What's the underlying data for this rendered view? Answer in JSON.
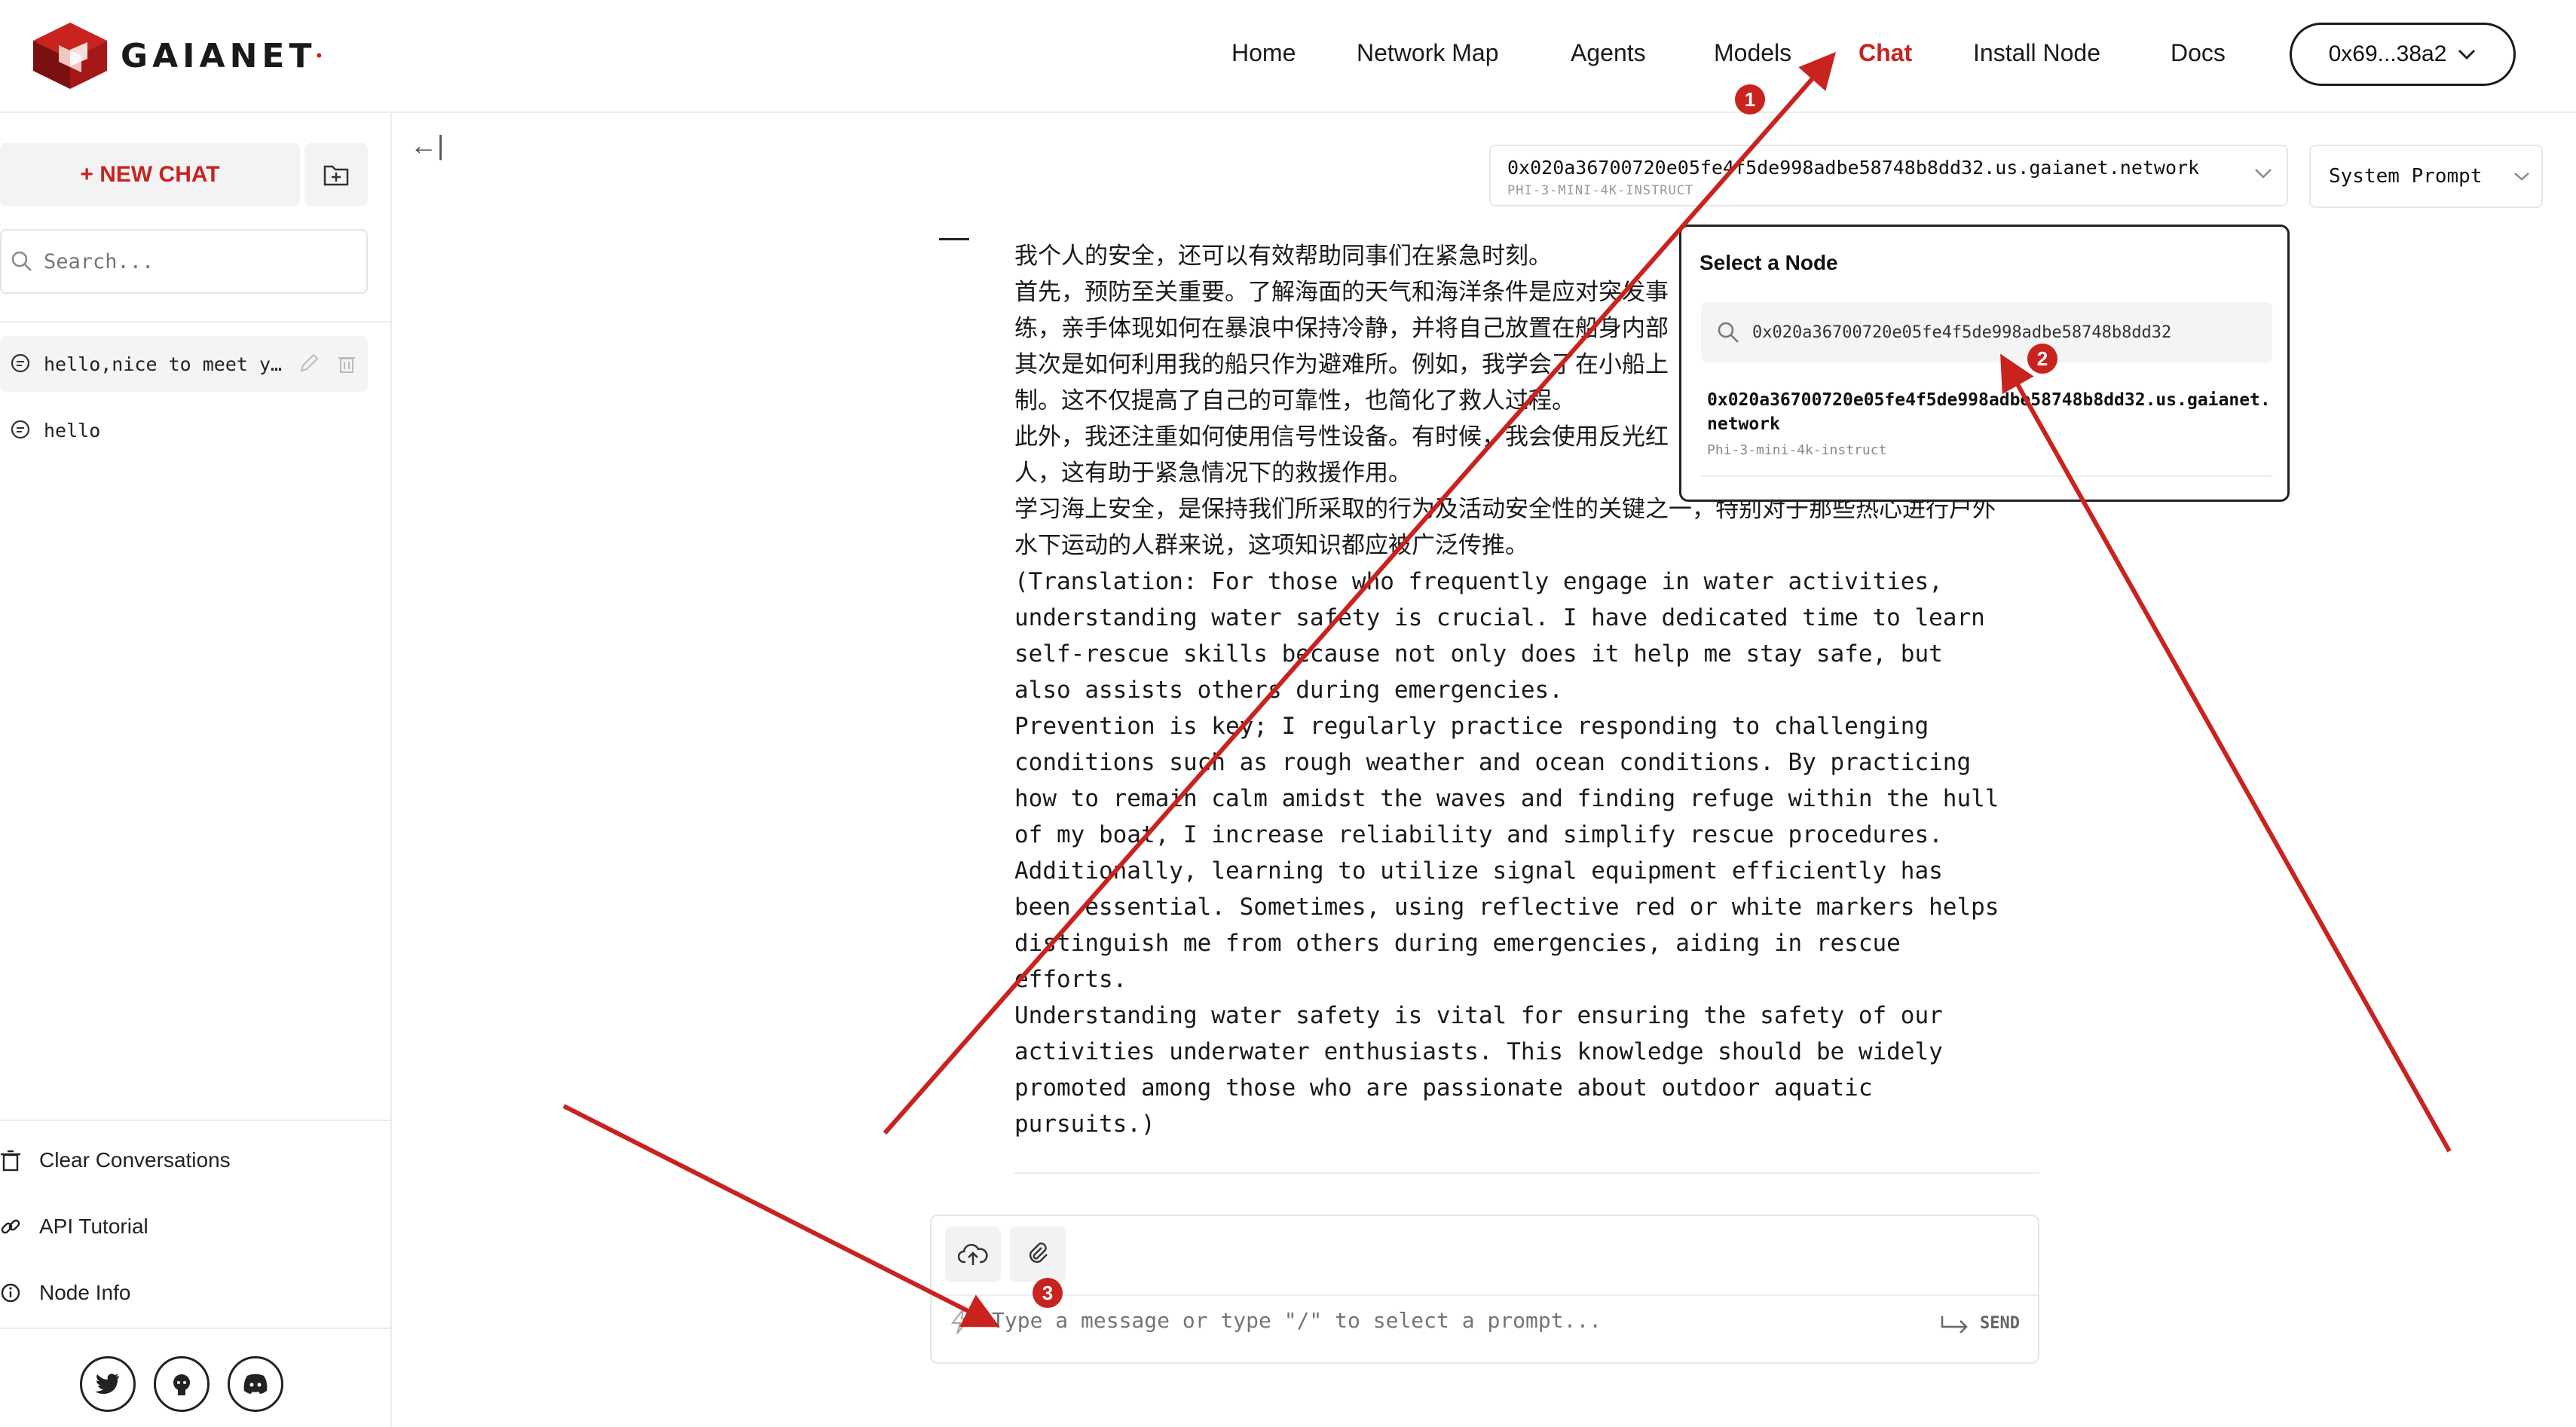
{
  "header": {
    "logo_text": "GAIANET",
    "nav": [
      {
        "label": "Home"
      },
      {
        "label": "Network Map"
      },
      {
        "label": "Agents"
      },
      {
        "label": "Models"
      },
      {
        "label": "Chat"
      },
      {
        "label": "Install Node"
      },
      {
        "label": "Docs"
      }
    ],
    "wallet_label": "0x69...38a2"
  },
  "sidebar": {
    "new_chat_label": "+ NEW CHAT",
    "search_placeholder": "Search...",
    "conversations": [
      {
        "title": "hello,nice to meet y…"
      },
      {
        "title": "hello"
      }
    ],
    "links": [
      {
        "label": "Clear Conversations"
      },
      {
        "label": "API Tutorial"
      },
      {
        "label": "Node Info"
      }
    ]
  },
  "main": {
    "collapse_glyph": "←|",
    "node": {
      "url": "0x020a36700720e05fe4f5de998adbe58748b8dd32.us.gaianet.network",
      "model": "PHI-3-MINI-4K-INSTRUCT"
    },
    "system_prompt_label": "System Prompt",
    "message_lines_zh": [
      "我个人的安全，还可以有效帮助同事们在紧急时刻。",
      "首先，预防至关重要。了解海面的天气和海洋条件是应对突发事",
      "练，亲手体现如何在暴浪中保持冷静，并将自己放置在船身内部",
      "其次是如何利用我的船只作为避难所。例如，我学会了在小船上",
      "制。这不仅提高了自己的可靠性，也简化了救人过程。",
      "此外，我还注重如何使用信号性设备。有时候，我会使用反光红",
      "人，这有助于紧急情况下的救援作用。",
      "学习海上安全，是保持我们所采取的行为及活动安全性的关键之一，特别对于那些热心进行户外",
      "水下运动的人群来说，这项知识都应被广泛传推。"
    ],
    "message_lines_en": [
      "(Translation: For those who frequently engage in water activities,",
      "understanding water safety is crucial. I have dedicated time to learn",
      "self-rescue skills because not only does it help me stay safe, but",
      "also assists others during emergencies.",
      "Prevention is key; I regularly practice responding to challenging",
      "conditions such as rough weather and ocean conditions. By practicing",
      "how to remain calm amidst the waves and finding refuge within the hull",
      "of my boat, I increase reliability and simplify rescue procedures.",
      "Additionally, learning to utilize signal equipment efficiently has",
      "been essential. Sometimes, using reflective red or white markers helps",
      "distinguish me from others during emergencies, aiding in rescue",
      "efforts.",
      "Understanding water safety is vital for ensuring the safety of our",
      "activities underwater enthusiasts. This knowledge should be widely",
      "promoted among those who are passionate about outdoor aquatic",
      "pursuits.)"
    ],
    "node_popover": {
      "title": "Select a Node",
      "search_value": "0x020a36700720e05fe4f5de998adbe58748b8dd32",
      "result_url": "0x020a36700720e05fe4f5de998adbe58748b8dd32.us.gaianet.network",
      "result_model": "Phi-3-mini-4k-instruct"
    },
    "composer": {
      "placeholder": "Type a message or type \"/\" to select a prompt...",
      "send_label": "SEND"
    }
  },
  "annotations": {
    "badges": [
      "1",
      "2",
      "3"
    ],
    "color": "#c8231f"
  }
}
